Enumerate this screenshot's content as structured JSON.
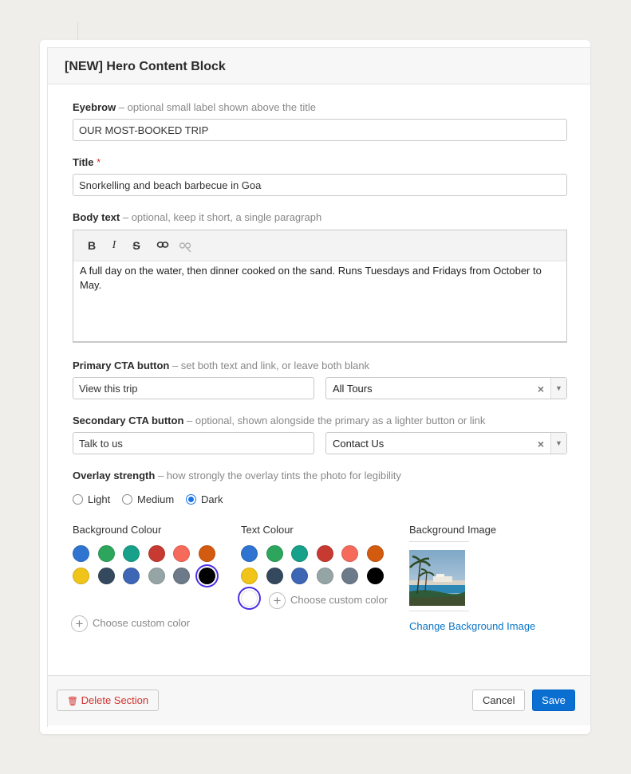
{
  "modal": {
    "title": "[NEW] Hero Content Block"
  },
  "eyebrow": {
    "label": "Eyebrow",
    "hint": " – optional small label shown above the title",
    "value": "OUR MOST-BOOKED TRIP"
  },
  "title_field": {
    "label": "Title",
    "required_mark": "*",
    "value": "Snorkelling and beach barbecue in Goa"
  },
  "body_text": {
    "label": "Body text",
    "hint": " – optional, keep it short, a single paragraph",
    "toolbar": {
      "bold": "B",
      "italic": "I",
      "strike": "S",
      "link": "🔗",
      "unlink": "⚯"
    },
    "value": "A full day on the water, then dinner cooked on the sand. Runs Tuesdays and Fridays from October to May."
  },
  "primary_cta": {
    "label": "Primary CTA button",
    "hint": " – set both text and link, or leave both blank",
    "text_value": "View this trip",
    "link_value": "All Tours"
  },
  "secondary_cta": {
    "label": "Secondary CTA button",
    "hint": " – optional, shown alongside the primary as a lighter button or link",
    "text_value": "Talk to us",
    "link_value": "Contact Us"
  },
  "select_icons": {
    "clear": "×",
    "arrow": "▼"
  },
  "overlay": {
    "label": "Overlay strength",
    "hint": " – how strongly the overlay tints the photo for legibility",
    "options": [
      "Light",
      "Medium",
      "Dark"
    ],
    "selected": 2
  },
  "background_colour": {
    "label": "Background Colour",
    "swatches": [
      "#2f74d0",
      "#2ea55c",
      "#17a08a",
      "#c73a31",
      "#f56a5b",
      "#d35b0f",
      "#f0c419",
      "#34495e",
      "#3d66b4",
      "#95a5a6",
      "#6c7a89",
      "#000000"
    ],
    "selected": 11,
    "custom_label": "Choose custom color",
    "plus": "+"
  },
  "text_colour": {
    "label": "Text Colour",
    "swatches": [
      "#2f74d0",
      "#2ea55c",
      "#17a08a",
      "#c73a31",
      "#f56a5b",
      "#d35b0f",
      "#f0c419",
      "#34495e",
      "#3d66b4",
      "#95a5a6",
      "#6c7a89",
      "#000000",
      "#ffffff"
    ],
    "selected": 12,
    "custom_label": "Choose custom color",
    "plus": "+"
  },
  "background_image": {
    "label": "Background Image",
    "change_label": "Change Background Image"
  },
  "footer": {
    "delete_icon": "🗑",
    "delete_label": "Delete Section",
    "cancel_label": "Cancel",
    "save_label": "Save"
  }
}
